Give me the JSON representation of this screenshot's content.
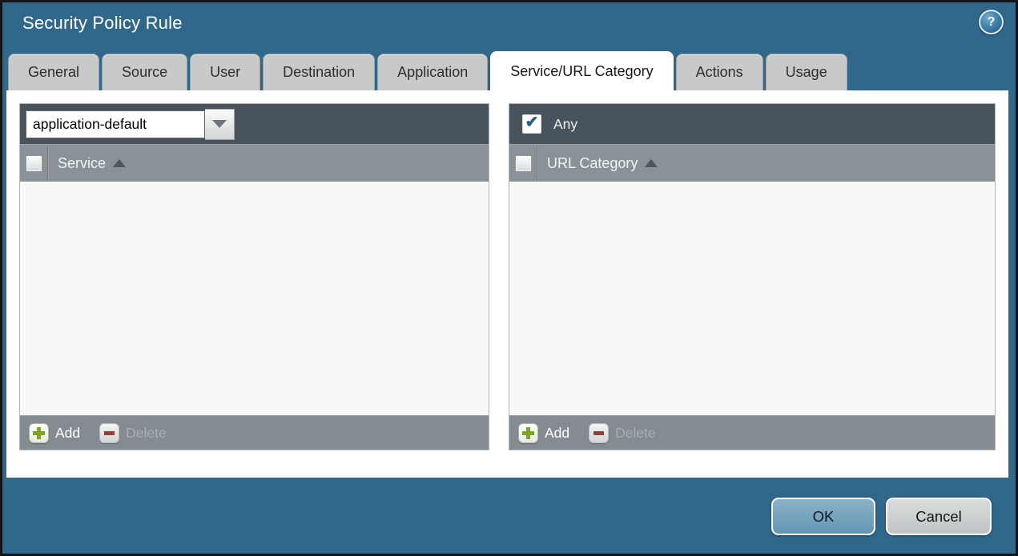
{
  "window": {
    "title": "Security Policy Rule"
  },
  "glyphs": {
    "help": "?",
    "check": "✔"
  },
  "tabs": [
    {
      "label": "General",
      "active": false
    },
    {
      "label": "Source",
      "active": false
    },
    {
      "label": "User",
      "active": false
    },
    {
      "label": "Destination",
      "active": false
    },
    {
      "label": "Application",
      "active": false
    },
    {
      "label": "Service/URL Category",
      "active": true
    },
    {
      "label": "Actions",
      "active": false
    },
    {
      "label": "Usage",
      "active": false
    }
  ],
  "service_panel": {
    "dropdown_value": "application-default",
    "column_header": "Service",
    "sort_direction": "asc",
    "select_all_checked": false,
    "rows": [],
    "add_label": "Add",
    "delete_label": "Delete",
    "delete_enabled": false
  },
  "url_category_panel": {
    "any_label": "Any",
    "any_checked": true,
    "column_header": "URL Category",
    "sort_direction": "asc",
    "select_all_checked": false,
    "rows": [],
    "add_label": "Add",
    "delete_label": "Delete",
    "delete_enabled": false
  },
  "actions": {
    "ok_label": "OK",
    "cancel_label": "Cancel"
  },
  "colors": {
    "dialog_bg": "#2F688A",
    "tab_inactive_bg": "#C7C9CA",
    "tab_active_bg": "#FFFFFF",
    "panel_toolbar_bg": "#49535B",
    "panel_header_bg": "#8A9297",
    "panel_footer_bg": "#848C92",
    "panel_body_bg": "#F8F8F7",
    "ok_button_bg": "#6FA3BE",
    "cancel_button_bg": "#C9CCCD",
    "add_icon_green": "#7CA61F",
    "delete_icon_maroon": "#93403C",
    "checkmark_teal": "#2A5E7C"
  }
}
